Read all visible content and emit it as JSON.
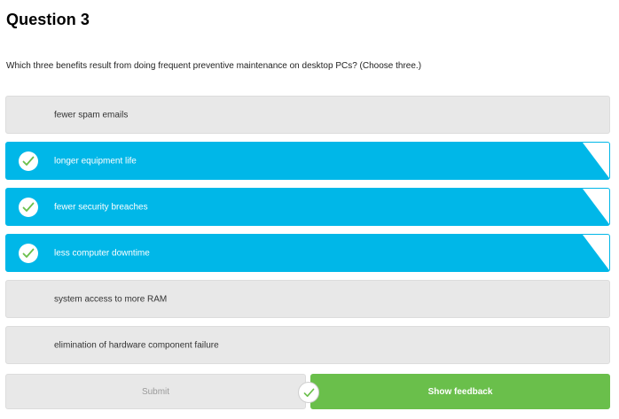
{
  "question": {
    "title": "Question 3",
    "prompt": "Which three benefits result from doing frequent preventive maintenance on desktop PCs? (Choose three.)"
  },
  "options": [
    {
      "label": "fewer spam emails",
      "selected": false
    },
    {
      "label": "longer equipment life",
      "selected": true
    },
    {
      "label": "fewer security breaches",
      "selected": true
    },
    {
      "label": "less computer downtime",
      "selected": true
    },
    {
      "label": "system access to more RAM",
      "selected": false
    },
    {
      "label": "elimination of hardware component failure",
      "selected": false
    }
  ],
  "actions": {
    "submit_label": "Submit",
    "feedback_label": "Show feedback"
  },
  "colors": {
    "selected": "#00b7e8",
    "unselected": "#e8e8e8",
    "feedback_button": "#6abf4b",
    "check": "#6abf4b"
  },
  "icons": {
    "option_check": "check-icon",
    "result": "check-icon"
  }
}
